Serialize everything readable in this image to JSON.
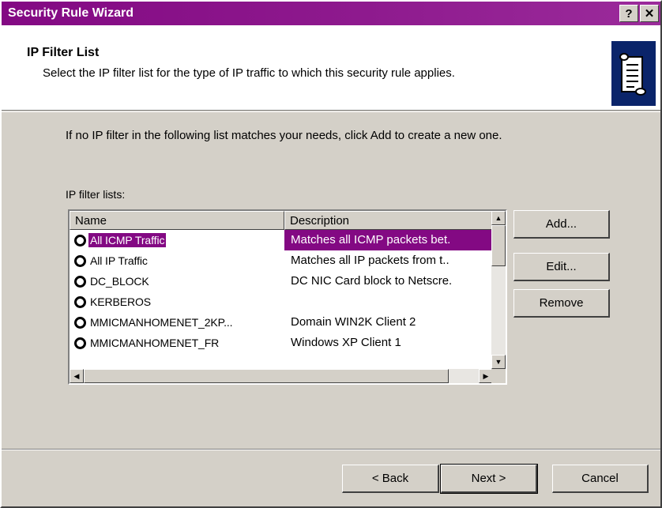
{
  "window": {
    "title": "Security Rule Wizard",
    "help_glyph": "?",
    "close_glyph": "✕"
  },
  "header": {
    "title": "IP Filter List",
    "subtitle": "Select the IP filter list for the type of IP traffic to which this security rule applies."
  },
  "intro": "If no IP filter in the following list matches your needs, click Add to create a new one.",
  "list": {
    "label": "IP filter lists:",
    "columns": [
      "Name",
      "Description"
    ],
    "rows": [
      {
        "name": "All ICMP Traffic",
        "description": "Matches all ICMP packets bet."
      },
      {
        "name": "All IP Traffic",
        "description": "Matches all IP packets from t.."
      },
      {
        "name": "DC_BLOCK",
        "description": "DC NIC Card block to Netscre."
      },
      {
        "name": "KERBEROS",
        "description": ""
      },
      {
        "name": "MMICMANHOMENET_2KP...",
        "description": "Domain WIN2K Client 2"
      },
      {
        "name": "MMICMANHOMENET_FR",
        "description": "Windows XP Client 1"
      }
    ],
    "selected_index": 0
  },
  "side_buttons": {
    "add": "Add...",
    "edit": "Edit...",
    "remove": "Remove"
  },
  "nav_buttons": {
    "back": "< Back",
    "next": "Next >",
    "cancel": "Cancel"
  },
  "colors": {
    "accent": "#830983",
    "face": "#d4d0c8"
  }
}
